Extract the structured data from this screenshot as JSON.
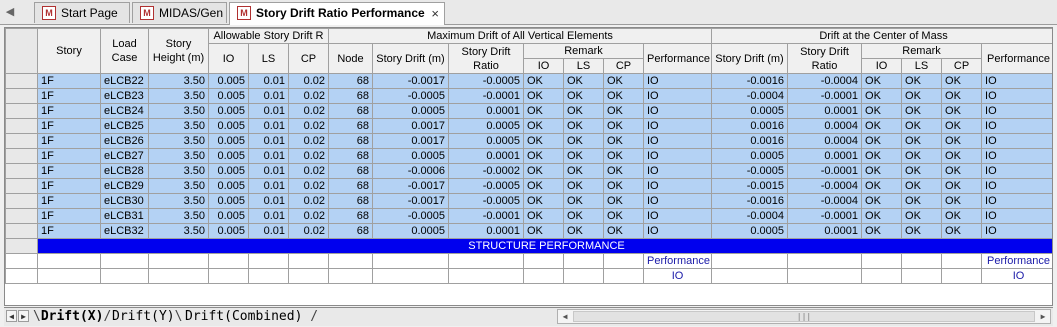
{
  "tabs": [
    {
      "label": "Start Page",
      "icon": "midas-logo-icon"
    },
    {
      "label": "MIDAS/Gen",
      "icon": "midas-logo-icon"
    },
    {
      "label": "Story Drift Ratio Performance",
      "icon": "midas-logo-icon",
      "active": true,
      "close": "×"
    }
  ],
  "header": {
    "story": "Story",
    "load_case": "Load Case",
    "story_height": "Story Height (m)",
    "allowable": "Allowable Story Drift R",
    "io": "IO",
    "ls": "LS",
    "cp": "CP",
    "max_drift": "Maximum Drift of All Vertical Elements",
    "node": "Node",
    "story_drift": "Story Drift (m)",
    "story_drift_ratio": "Story Drift Ratio",
    "remark": "Remark",
    "performance": "Performance",
    "center_mass": "Drift at the Center of Mass"
  },
  "rows": [
    [
      "1F",
      "eLCB22",
      "3.50",
      "0.005",
      "0.01",
      "0.02",
      "68",
      "-0.0017",
      "-0.0005",
      "OK",
      "OK",
      "OK",
      "IO",
      "-0.0016",
      "-0.0004",
      "OK",
      "OK",
      "OK",
      "IO"
    ],
    [
      "1F",
      "eLCB23",
      "3.50",
      "0.005",
      "0.01",
      "0.02",
      "68",
      "-0.0005",
      "-0.0001",
      "OK",
      "OK",
      "OK",
      "IO",
      "-0.0004",
      "-0.0001",
      "OK",
      "OK",
      "OK",
      "IO"
    ],
    [
      "1F",
      "eLCB24",
      "3.50",
      "0.005",
      "0.01",
      "0.02",
      "68",
      "0.0005",
      "0.0001",
      "OK",
      "OK",
      "OK",
      "IO",
      "0.0005",
      "0.0001",
      "OK",
      "OK",
      "OK",
      "IO"
    ],
    [
      "1F",
      "eLCB25",
      "3.50",
      "0.005",
      "0.01",
      "0.02",
      "68",
      "0.0017",
      "0.0005",
      "OK",
      "OK",
      "OK",
      "IO",
      "0.0016",
      "0.0004",
      "OK",
      "OK",
      "OK",
      "IO"
    ],
    [
      "1F",
      "eLCB26",
      "3.50",
      "0.005",
      "0.01",
      "0.02",
      "68",
      "0.0017",
      "0.0005",
      "OK",
      "OK",
      "OK",
      "IO",
      "0.0016",
      "0.0004",
      "OK",
      "OK",
      "OK",
      "IO"
    ],
    [
      "1F",
      "eLCB27",
      "3.50",
      "0.005",
      "0.01",
      "0.02",
      "68",
      "0.0005",
      "0.0001",
      "OK",
      "OK",
      "OK",
      "IO",
      "0.0005",
      "0.0001",
      "OK",
      "OK",
      "OK",
      "IO"
    ],
    [
      "1F",
      "eLCB28",
      "3.50",
      "0.005",
      "0.01",
      "0.02",
      "68",
      "-0.0006",
      "-0.0002",
      "OK",
      "OK",
      "OK",
      "IO",
      "-0.0005",
      "-0.0001",
      "OK",
      "OK",
      "OK",
      "IO"
    ],
    [
      "1F",
      "eLCB29",
      "3.50",
      "0.005",
      "0.01",
      "0.02",
      "68",
      "-0.0017",
      "-0.0005",
      "OK",
      "OK",
      "OK",
      "IO",
      "-0.0015",
      "-0.0004",
      "OK",
      "OK",
      "OK",
      "IO"
    ],
    [
      "1F",
      "eLCB30",
      "3.50",
      "0.005",
      "0.01",
      "0.02",
      "68",
      "-0.0017",
      "-0.0005",
      "OK",
      "OK",
      "OK",
      "IO",
      "-0.0016",
      "-0.0004",
      "OK",
      "OK",
      "OK",
      "IO"
    ],
    [
      "1F",
      "eLCB31",
      "3.50",
      "0.005",
      "0.01",
      "0.02",
      "68",
      "-0.0005",
      "-0.0001",
      "OK",
      "OK",
      "OK",
      "IO",
      "-0.0004",
      "-0.0001",
      "OK",
      "OK",
      "OK",
      "IO"
    ],
    [
      "1F",
      "eLCB32",
      "3.50",
      "0.005",
      "0.01",
      "0.02",
      "68",
      "0.0005",
      "0.0001",
      "OK",
      "OK",
      "OK",
      "IO",
      "0.0005",
      "0.0001",
      "OK",
      "OK",
      "OK",
      "IO"
    ]
  ],
  "banner": "STRUCTURE PERFORMANCE",
  "summary": {
    "label1": "Performance",
    "value1": "IO",
    "label2": "Performance",
    "value2": "IO"
  },
  "sheet_tabs": [
    "Drift(X)",
    "Drift(Y)",
    "Drift(Combined)"
  ],
  "colors": {
    "selection": "#b4d2f4",
    "banner": "#0000ee",
    "link_text": "#1a1aa8"
  }
}
